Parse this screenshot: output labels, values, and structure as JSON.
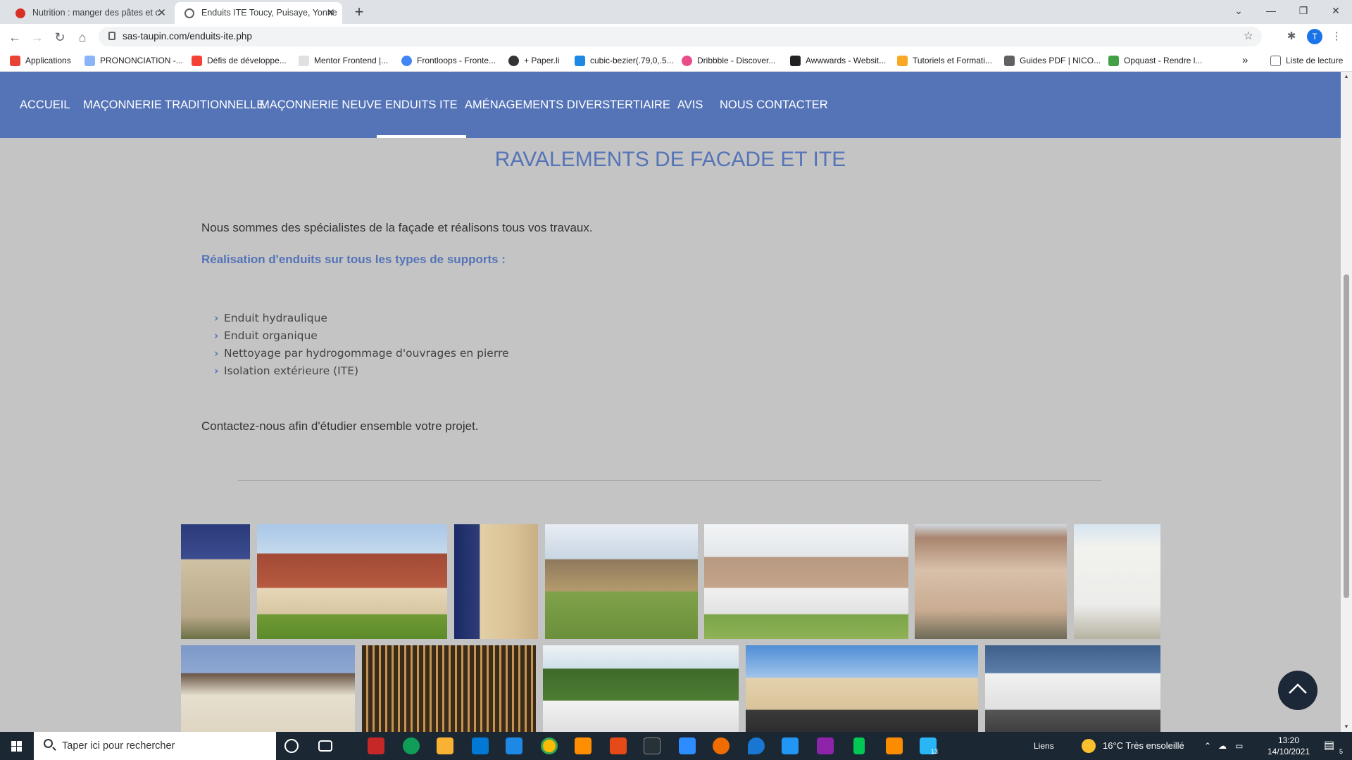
{
  "browser": {
    "tabs": [
      {
        "title": "Nutrition : manger des pâtes et c",
        "active": false
      },
      {
        "title": "Enduits ITE Toucy, Puisaye, Yonne",
        "active": true
      }
    ],
    "new_tab": "+",
    "window_controls": {
      "minimize": "—",
      "restore": "❐",
      "close": "✕",
      "tab_search": "⌄"
    },
    "url": "sas-taupin.com/enduits-ite.php",
    "avatar_letter": "T",
    "bookmarks": [
      {
        "label": "Applications",
        "color": "#ea4335"
      },
      {
        "label": "PRONONCIATION -...",
        "color": "#8ab4f8"
      },
      {
        "label": "Défis de développe...",
        "color": "#f44336"
      },
      {
        "label": "Mentor Frontend |...",
        "color": "#e0e0e0"
      },
      {
        "label": "Frontloops - Fronte...",
        "color": "#4285f4"
      },
      {
        "label": "+ Paper.li",
        "color": "#333333"
      },
      {
        "label": "cubic-bezier(.79,0,.5...",
        "color": "#1e88e5"
      },
      {
        "label": "Dribbble - Discover...",
        "color": "#ea4c89"
      },
      {
        "label": "Awwwards - Websit...",
        "color": "#222222"
      },
      {
        "label": "Tutoriels et Formati...",
        "color": "#f9a825"
      },
      {
        "label": "Guides PDF | NICO...",
        "color": "#616161"
      },
      {
        "label": "Opquast - Rendre l...",
        "color": "#43a047"
      }
    ],
    "bookmarks_more": "»",
    "reading_list": "Liste de lecture"
  },
  "site": {
    "nav": [
      {
        "label": "ACCUEIL",
        "active": false
      },
      {
        "label": "MAÇONNERIE TRADITIONNELLE",
        "active": false
      },
      {
        "label": "MAÇONNERIE NEUVE",
        "active": false
      },
      {
        "label": "ENDUITS ITE",
        "active": true
      },
      {
        "label": "AMÉNAGEMENTS DIVERS",
        "active": false
      },
      {
        "label": "TERTIAIRE",
        "active": false
      },
      {
        "label": "AVIS",
        "active": false
      },
      {
        "label": "NOUS CONTACTER",
        "active": false
      }
    ],
    "title": "RAVALEMENTS DE FACADE ET ITE",
    "intro": "Nous sommes des spécialistes de la façade et réalisons tous vos travaux.",
    "subheading": "Réalisation d'enduits sur tous les types de supports :",
    "services": [
      "Enduit hydraulique",
      "Enduit organique",
      "Nettoyage par hydrogommage d'ouvrages en pierre",
      "Isolation extérieure (ITE)"
    ],
    "outro": "Contactez-nous afin d'étudier ensemble votre projet.",
    "accent_color": "#5574b7",
    "gallery_row1": [
      {
        "name": "stone-house-photo"
      },
      {
        "name": "brick-houses-photo"
      },
      {
        "name": "stone-tower-photo"
      },
      {
        "name": "farm-barn-photo"
      },
      {
        "name": "modern-building-photo"
      },
      {
        "name": "brick-villa-photo"
      },
      {
        "name": "white-house-photo"
      }
    ],
    "gallery_row2": [
      {
        "name": "cream-house-photo"
      },
      {
        "name": "wood-cladding-photo"
      },
      {
        "name": "house-trees-photo"
      },
      {
        "name": "school-building-photo"
      },
      {
        "name": "cube-house-photo"
      }
    ]
  },
  "taskbar": {
    "search_placeholder": "Taper ici pour rechercher",
    "links": "Liens",
    "weather": "16°C  Très ensoleillé",
    "time": "13:20",
    "date": "14/10/2021",
    "notification_count": "5",
    "badge_13": "13"
  }
}
